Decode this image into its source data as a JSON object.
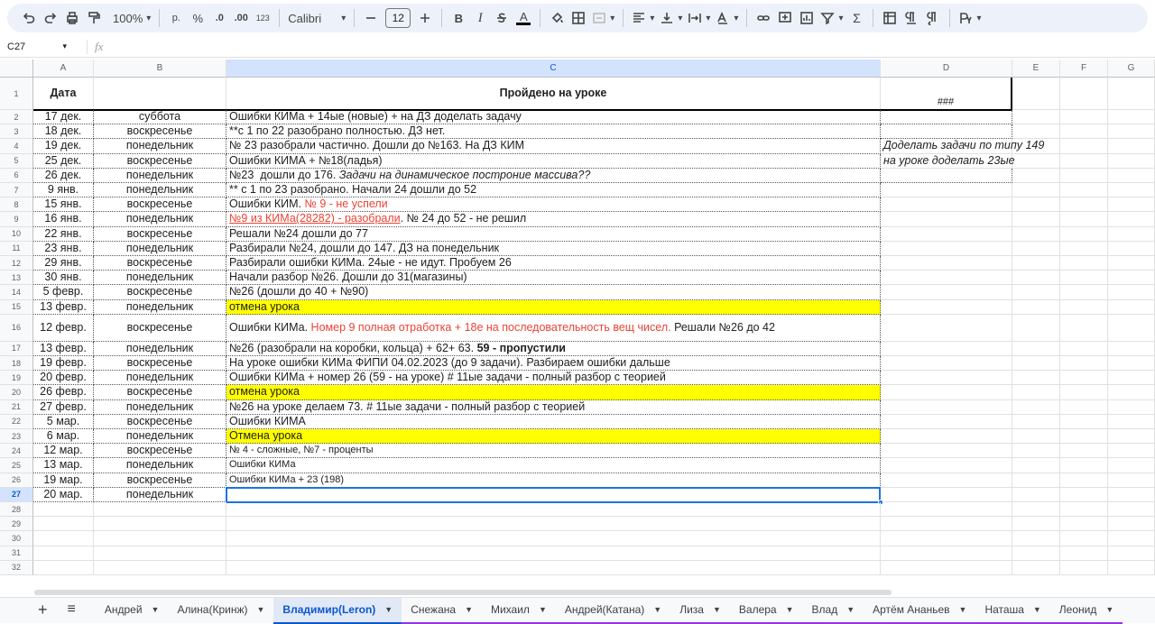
{
  "toolbar": {
    "zoom": "100%",
    "currency": "р.",
    "percent": "%",
    "dec_decrease": ".0",
    "dec_increase": ".00",
    "number_format": "123",
    "font_name": "Calibri",
    "font_size": "12",
    "bold": "B",
    "italic": "I",
    "text_color_letter": "A",
    "sigma": "Σ"
  },
  "formula_bar": {
    "cell_ref": "C27",
    "fx": "fx"
  },
  "columns": [
    "A",
    "B",
    "C",
    "D",
    "E",
    "F",
    "G"
  ],
  "header_row": {
    "a": "Дата",
    "c": "Пройдено на уроке",
    "d": "###"
  },
  "rows": [
    {
      "num": "2",
      "a": "17 дек.",
      "b": "суббота",
      "c": "Ошибки КИМа + 14ые (новые) + на ДЗ доделать задачу"
    },
    {
      "num": "3",
      "a": "18 дек.",
      "b": "воскресенье",
      "c": "**с 1 по 22 разобрано полностью. ДЗ нет."
    },
    {
      "num": "4",
      "a": "19 дек.",
      "b": "понедельник",
      "c": "№ 23 разобрали частично. Дошли до №163. На ДЗ КИМ",
      "d": "Доделать задачи по типу 149"
    },
    {
      "num": "5",
      "a": "25 дек.",
      "b": "воскресенье",
      "c": "Ошибки КИМА + №18(ладья)",
      "d": "на уроке доделать 23ые"
    },
    {
      "num": "6",
      "a": "26 дек.",
      "b": "понедельник",
      "c1": "№23  дошли до 176. ",
      "c2": "Задачи на динамическое построние массива??"
    },
    {
      "num": "7",
      "a": "9 янв.",
      "b": "понедельник",
      "c": "** с 1 по 23 разобрано. Начали 24 дошли до 52"
    },
    {
      "num": "8",
      "a": "15 янв.",
      "b": "воскресенье",
      "c1": "Ошибки КИМ. ",
      "c2": "№ 9 - не успели"
    },
    {
      "num": "9",
      "a": "16 янв.",
      "b": "понедельник",
      "c1": "№9 из КИМа(28282) - разобрали",
      "c2": ". № 24 до 52 - не решил"
    },
    {
      "num": "10",
      "a": "22 янв.",
      "b": "воскресенье",
      "c": "Решали №24 дошли до 77"
    },
    {
      "num": "11",
      "a": "23 янв.",
      "b": "понедельник",
      "c": "Разбирали №24, дошли до 147. ДЗ на понедельник"
    },
    {
      "num": "12",
      "a": "29 янв.",
      "b": "воскресенье",
      "c": "Разбирали ошибки КИМа. 24ые - не идут. Пробуем 26"
    },
    {
      "num": "13",
      "a": "30 янв.",
      "b": "понедельник",
      "c": "Начали разбор №26. Дошли до 31(магазины)"
    },
    {
      "num": "14",
      "a": "5 февр.",
      "b": "воскресенье",
      "c": "№26 (дошли до 40 + №90)"
    },
    {
      "num": "15",
      "a": "13 февр.",
      "b": "понедельник",
      "c": "отмена урока"
    },
    {
      "num": "16",
      "a": "12 февр.",
      "b": "воскресенье",
      "c1": "Ошибки КИМа. ",
      "c2": "Номер 9 полная отработка + 18е на последовательность вещ чисел.",
      "c3": " Решали №26 до 42"
    },
    {
      "num": "17",
      "a": "13 февр.",
      "b": "понедельник",
      "c1": "№26 (разобрали на коробки, кольца) + 62+ 63. ",
      "c2": "59 - пропустили"
    },
    {
      "num": "18",
      "a": "19 февр.",
      "b": "воскресенье",
      "c": "На уроке ошибки КИМа ФИПИ 04.02.2023  (до 9 задачи). Разбираем ошибки дальше"
    },
    {
      "num": "19",
      "a": "20 февр.",
      "b": "понедельник",
      "c": "Ошибки КИМа + номер 26 (59 - на уроке)   # 11ые задачи - полный разбор с теорией"
    },
    {
      "num": "20",
      "a": "26 февр.",
      "b": "воскресенье",
      "c": "отмена урока"
    },
    {
      "num": "21",
      "a": "27 февр.",
      "b": "понедельник",
      "c": "№26 на уроке делаем 73.  # 11ые задачи - полный разбор с теорией"
    },
    {
      "num": "22",
      "a": "5 мар.",
      "b": "воскресенье",
      "c": "Ошибки КИМА"
    },
    {
      "num": "23",
      "a": "6 мар.",
      "b": "понедельник",
      "c": "Отмена урока"
    },
    {
      "num": "24",
      "a": "12 мар.",
      "b": "воскресенье",
      "c": "№ 4 - сложные, №7 - проценты"
    },
    {
      "num": "25",
      "a": "13 мар.",
      "b": "понедельник",
      "c": "Ошибки КИМа"
    },
    {
      "num": "26",
      "a": "19 мар.",
      "b": "воскресенье",
      "c": "Ошибки КИМа + 23 (198)"
    },
    {
      "num": "27",
      "a": "20 мар.",
      "b": "понедельник",
      "c": ""
    }
  ],
  "empty_rows": [
    "28",
    "29",
    "30",
    "31",
    "32"
  ],
  "tabs": [
    "Андрей",
    "Алина(Кринж)",
    "Владимир(Leron)",
    "Снежана",
    "Михаил",
    "Андрей(Катана)",
    "Лиза",
    "Валера",
    "Влад",
    "Артём Ананьев",
    "Наташа",
    "Леонид"
  ],
  "active_tab": "Владимир(Leron)",
  "colors": {
    "yellow": "#ffff00",
    "red": "#ea4335",
    "accent": "#1a73e8"
  }
}
